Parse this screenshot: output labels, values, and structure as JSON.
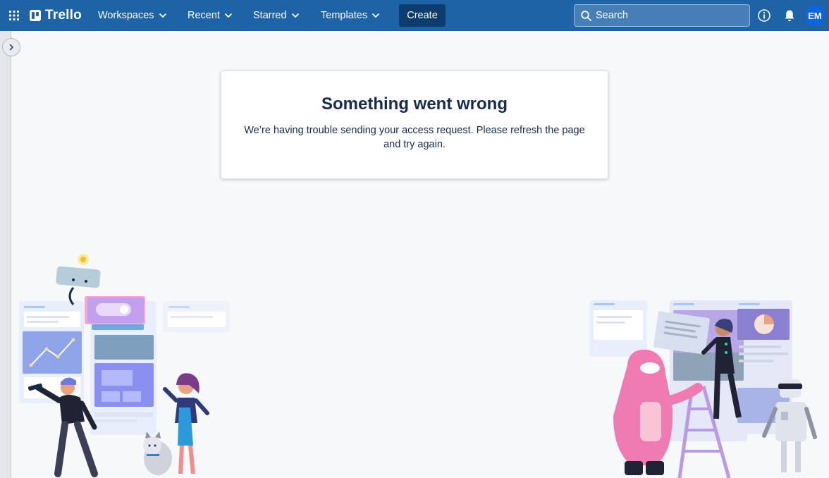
{
  "header": {
    "logo_text": "Trello",
    "nav": [
      {
        "label": "Workspaces"
      },
      {
        "label": "Recent"
      },
      {
        "label": "Starred"
      },
      {
        "label": "Templates"
      }
    ],
    "create_label": "Create",
    "search_placeholder": "Search",
    "avatar_initials": "EM",
    "icons": [
      "apps-grid-icon",
      "info-icon",
      "bell-icon",
      "search-icon",
      "chevron-down-icon"
    ]
  },
  "sidebar": {
    "toggle_icon": "chevron-right-icon"
  },
  "error": {
    "title": "Something went wrong",
    "message": "We’re having trouble sending your access request. Please refresh the page and try again."
  },
  "colors": {
    "header_bg": "#1d63a6",
    "create_bg": "#0d3c6e",
    "page_bg": "#f7f8fa",
    "text": "#172b4d",
    "avatar_bg": "#0c66e4"
  }
}
